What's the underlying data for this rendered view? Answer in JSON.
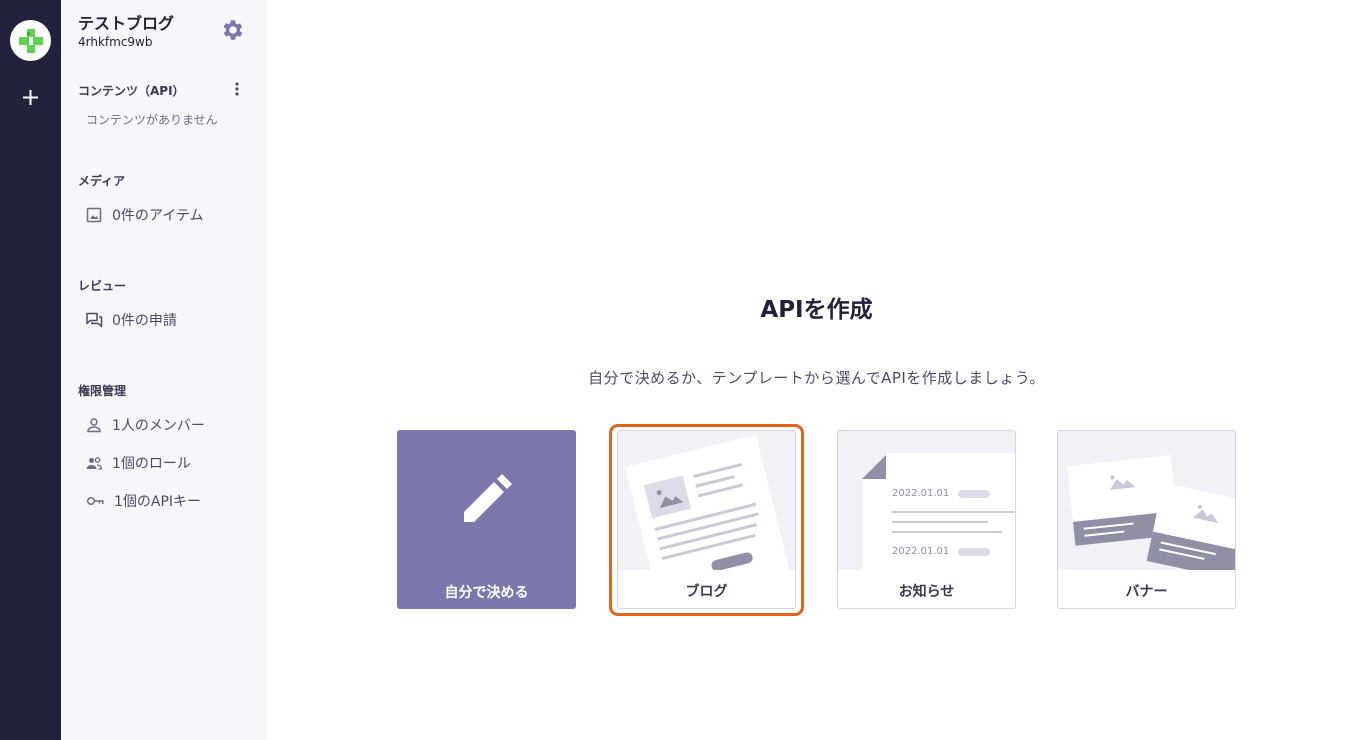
{
  "sidebar": {
    "service_name": "テストブログ",
    "service_id": "4rhkfmc9wb",
    "sections": {
      "content": {
        "title": "コンテンツ（API）",
        "empty": "コンテンツがありません"
      },
      "media": {
        "title": "メディア",
        "item": "0件のアイテム"
      },
      "review": {
        "title": "レビュー",
        "item": "0件の申請"
      },
      "permissions": {
        "title": "権限管理",
        "members": "1人のメンバー",
        "roles": "1個のロール",
        "api_keys": "1個のAPIキー"
      }
    }
  },
  "main": {
    "title": "APIを作成",
    "subtitle": "自分で決めるか、テンプレートから選んでAPIを作成しましょう。",
    "cards": {
      "custom": "自分で決める",
      "blog": "ブログ",
      "news": "お知らせ",
      "banner": "バナー"
    },
    "news_dates": [
      "2022.01.01",
      "2022.01.01"
    ],
    "selected_card": "blog"
  },
  "colors": {
    "rail": "#21213b",
    "sidebar": "#f6f7fb",
    "accent": "#7b78ae",
    "selection": "#e0651a",
    "logo_green": "#5ed34f"
  },
  "icons": {
    "logo": "service-logo-icon",
    "add": "plus-icon",
    "settings": "gear-icon",
    "menu": "kebab-menu-icon",
    "media": "image-icon",
    "review": "chat-icon",
    "members": "person-icon",
    "roles": "people-icon",
    "api_keys": "key-icon",
    "custom": "pencil-icon"
  }
}
